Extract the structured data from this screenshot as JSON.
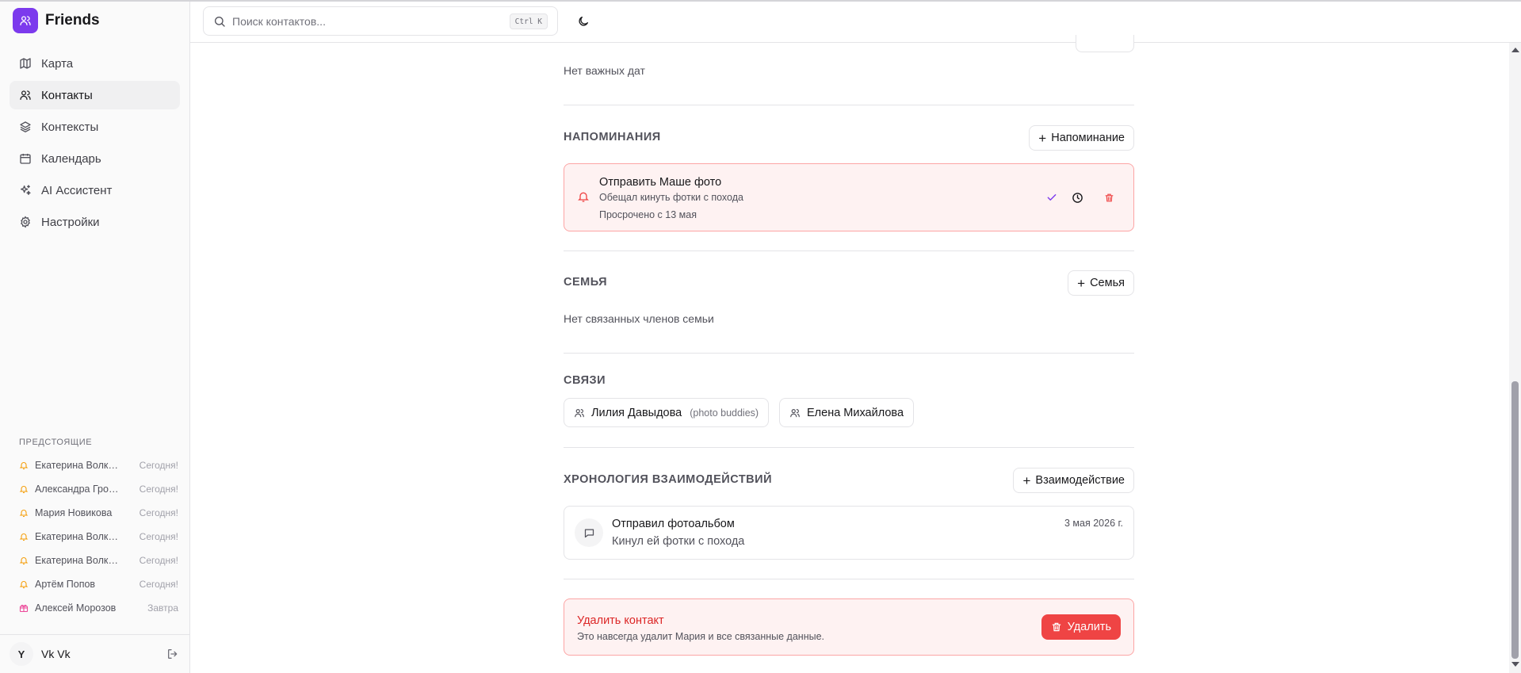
{
  "app": {
    "name": "Friends",
    "accent": "#7c3aed"
  },
  "sidebar": {
    "nav": [
      {
        "label": "Карта",
        "icon": "map-icon"
      },
      {
        "label": "Контакты",
        "icon": "users-icon",
        "active": true
      },
      {
        "label": "Контексты",
        "icon": "layers-icon"
      },
      {
        "label": "Календарь",
        "icon": "calendar-icon"
      },
      {
        "label": "AI Ассистент",
        "icon": "sparkles-icon"
      },
      {
        "label": "Настройки",
        "icon": "gear-icon"
      }
    ],
    "upcoming_title": "Предстоящие",
    "upcoming": [
      {
        "name": "Екатерина Волкова",
        "when": "Сегодня!",
        "icon": "bell-icon"
      },
      {
        "name": "Александра Громова",
        "when": "Сегодня!",
        "icon": "bell-icon"
      },
      {
        "name": "Мария Новикова",
        "when": "Сегодня!",
        "icon": "bell-icon"
      },
      {
        "name": "Екатерина Волкова",
        "when": "Сегодня!",
        "icon": "bell-icon"
      },
      {
        "name": "Екатерина Волкова",
        "when": "Сегодня!",
        "icon": "bell-icon"
      },
      {
        "name": "Артём Попов",
        "when": "Сегодня!",
        "icon": "bell-icon"
      },
      {
        "name": "Алексей Морозов",
        "when": "Завтра",
        "icon": "gift-icon"
      }
    ],
    "user": {
      "initial": "Y",
      "name": "Vk Vk"
    }
  },
  "topbar": {
    "search_placeholder": "Поиск контактов...",
    "shortcut": "Ctrl K"
  },
  "content": {
    "important_dates_empty": "Нет важных дат",
    "reminders": {
      "title": "Напоминания",
      "add_label": "Напоминание",
      "item": {
        "title": "Отправить Маше фото",
        "description": "Обещал кинуть фотки с похода",
        "overdue": "Просрочено с 13 мая"
      }
    },
    "family": {
      "title": "Семья",
      "add_label": "Семья",
      "empty": "Нет связанных членов семьи"
    },
    "connections": {
      "title": "Связи",
      "items": [
        {
          "name": "Лилия Давыдова",
          "tag": "(photo buddies)"
        },
        {
          "name": "Елена Михайлова",
          "tag": ""
        }
      ]
    },
    "timeline": {
      "title": "Хронология взаимодействий",
      "add_label": "Взаимодействие",
      "item": {
        "title": "Отправил фотоальбом",
        "description": "Кинул ей фотки с похода",
        "date": "3 мая 2026 г."
      }
    },
    "danger": {
      "title": "Удалить контакт",
      "description": "Это навсегда удалит Мария и все связанные данные.",
      "button": "Удалить"
    }
  },
  "colors": {
    "danger": "#ef4444",
    "danger_bg": "#fef2f2",
    "danger_border": "#fca5a5",
    "bell": "#f59e0b",
    "gift": "#ec4899"
  }
}
